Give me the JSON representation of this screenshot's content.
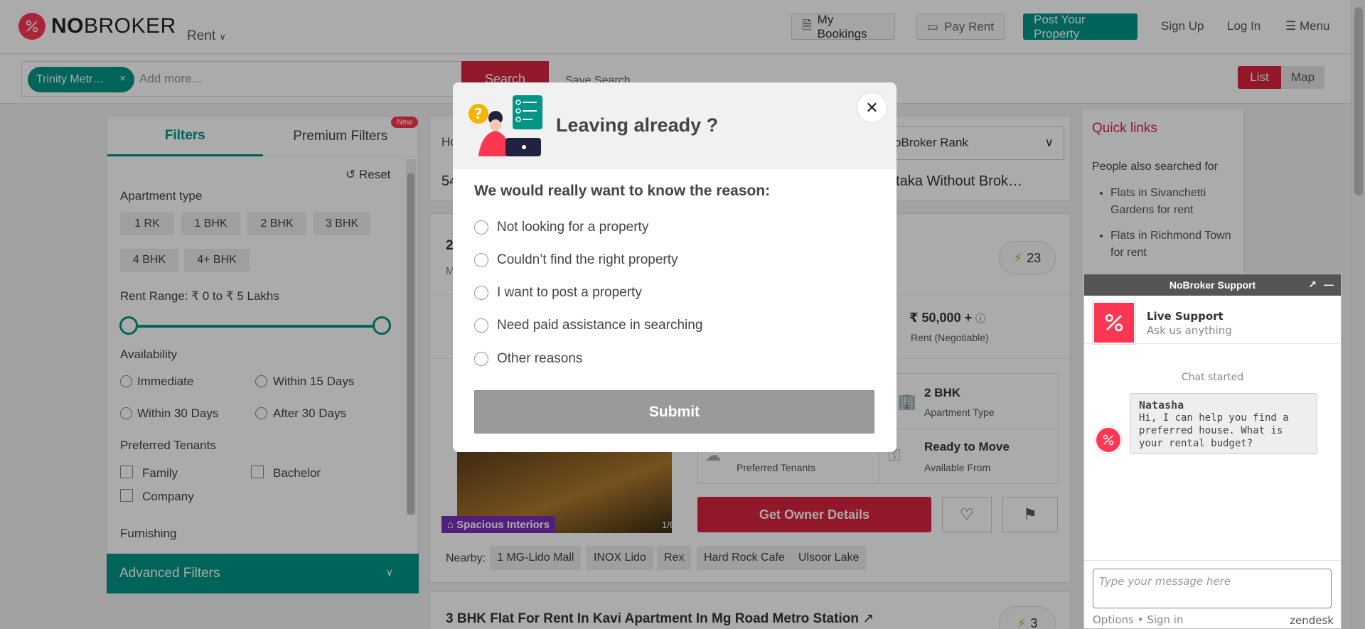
{
  "header": {
    "logo_text_bold": "NO",
    "logo_text_rest": "BROKER",
    "rent_dropdown": "Rent",
    "my_bookings": "My Bookings",
    "pay_rent": "Pay Rent",
    "post_property": "Post Your Property",
    "sign_up": "Sign Up",
    "log_in": "Log In",
    "menu": "Menu"
  },
  "search": {
    "chip": "Trinity Metr…",
    "chip_remove": "×",
    "placeholder": "Add more...",
    "button": "Search",
    "save_search": "Save Search",
    "view_list": "List",
    "view_map": "Map"
  },
  "filters": {
    "tab_filters": "Filters",
    "tab_premium": "Premium Filters",
    "new_badge": "New",
    "reset": "Reset",
    "apartment_type_label": "Apartment type",
    "apartment_types": [
      "1 RK",
      "1 BHK",
      "2 BHK",
      "3 BHK",
      "4 BHK",
      "4+ BHK"
    ],
    "rent_range_label": "Rent Range: ₹ 0 to ₹ 5 Lakhs",
    "availability_label": "Availability",
    "availability": [
      "Immediate",
      "Within 15 Days",
      "Within 30 Days",
      "After 30 Days"
    ],
    "tenants_label": "Preferred Tenants",
    "tenants": [
      "Family",
      "Bachelor",
      "Company"
    ],
    "furnishing_label": "Furnishing",
    "advanced": "Advanced Filters"
  },
  "listing": {
    "breadcrumb_fragment": "Ho",
    "sort": "oBroker Rank",
    "results_title_start": "54",
    "results_title_end": "rnataka Without Brok…",
    "card_title_fragment": "2",
    "card_sub_fragment": "M",
    "boost_count": "23",
    "price": "₹ 50,000 +",
    "price_sub": "Rent (Negotiable)",
    "photo_tag": "Spacious Interiors",
    "photo_count": "1/6",
    "bhk": "2 BHK",
    "bhk_label": "Apartment Type",
    "tenants_label": "Preferred Tenants",
    "ready": "Ready to Move",
    "ready_label": "Available From",
    "owner_button": "Get Owner Details",
    "nearby_label": "Nearby:",
    "nearby": [
      "1 MG-Lido Mall",
      "INOX Lido",
      "Rex",
      "Hard Rock Cafe",
      "Ulsoor Lake"
    ],
    "next_title": "3 BHK Flat For Rent In Kavi Apartment In Mg Road Metro Station",
    "next_count": "3"
  },
  "quicklinks": {
    "title": "Quick links",
    "sub": "People also searched for",
    "items": [
      "Flats in Sivanchetti Gardens for rent",
      "Flats in Richmond Town for rent"
    ]
  },
  "modal": {
    "title": "Leaving already ?",
    "close": "✕",
    "question": "We would really want to know the reason:",
    "options": [
      "Not looking for a property",
      "Couldn’t find the right property",
      "I want to post a property",
      "Need paid assistance in searching",
      "Other reasons"
    ],
    "submit": "Submit"
  },
  "chat": {
    "bar_title": "NoBroker Support",
    "popout": "↗",
    "minimize": "—",
    "agent_name": "Live Support",
    "agent_sub": "Ask us anything",
    "started": "Chat started",
    "sender": "Natasha",
    "message": "Hi, I can help you find a preferred house. What is your rental budget?",
    "input_placeholder": "Type your message here",
    "footer_options": "Options",
    "footer_sep": "•",
    "footer_signin": "Sign in",
    "brand": "zendesk"
  },
  "colors": {
    "brand_red": "#d8243f",
    "teal": "#009587",
    "logo_red": "#fd3752"
  }
}
